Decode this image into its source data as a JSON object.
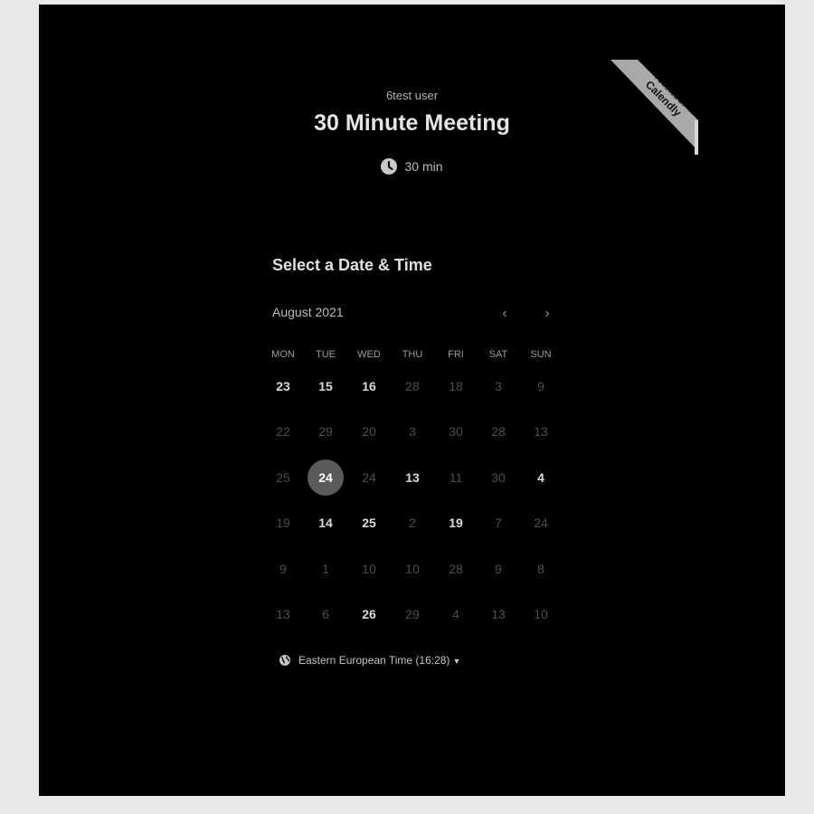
{
  "badge": {
    "top_text": "POWERED BY",
    "brand": "Calendly"
  },
  "event": {
    "owner": "6test user",
    "title": "30 Minute Meeting",
    "duration": "30 min"
  },
  "calendar": {
    "heading": "Select a Date & Time",
    "month_label": "August 2021",
    "weekdays": [
      "MON",
      "TUE",
      "WED",
      "THU",
      "FRI",
      "SAT",
      "SUN"
    ],
    "selected_day": "24",
    "days": [
      [
        {
          "label": "23",
          "available": true
        },
        {
          "label": "15",
          "available": true
        },
        {
          "label": "16",
          "available": true
        },
        {
          "label": "28",
          "available": false
        },
        {
          "label": "18",
          "available": false
        },
        {
          "label": "3",
          "available": false
        },
        {
          "label": "9",
          "available": false
        }
      ],
      [
        {
          "label": "22",
          "available": false
        },
        {
          "label": "29",
          "available": false
        },
        {
          "label": "20",
          "available": false
        },
        {
          "label": "3",
          "available": false
        },
        {
          "label": "30",
          "available": false
        },
        {
          "label": "28",
          "available": false
        },
        {
          "label": "13",
          "available": false
        }
      ],
      [
        {
          "label": "25",
          "available": false
        },
        {
          "label": "24",
          "available": true,
          "selected": true
        },
        {
          "label": "24",
          "available": false
        },
        {
          "label": "13",
          "available": true
        },
        {
          "label": "11",
          "available": false
        },
        {
          "label": "30",
          "available": false
        },
        {
          "label": "4",
          "available": true
        }
      ],
      [
        {
          "label": "19",
          "available": false
        },
        {
          "label": "14",
          "available": true
        },
        {
          "label": "25",
          "available": true
        },
        {
          "label": "2",
          "available": false
        },
        {
          "label": "19",
          "available": true
        },
        {
          "label": "7",
          "available": false
        },
        {
          "label": "24",
          "available": false
        }
      ],
      [
        {
          "label": "9",
          "available": false
        },
        {
          "label": "1",
          "available": false
        },
        {
          "label": "10",
          "available": false
        },
        {
          "label": "10",
          "available": false
        },
        {
          "label": "28",
          "available": false
        },
        {
          "label": "9",
          "available": false
        },
        {
          "label": "8",
          "available": false
        }
      ],
      [
        {
          "label": "13",
          "available": false
        },
        {
          "label": "6",
          "available": false
        },
        {
          "label": "26",
          "available": true
        },
        {
          "label": "29",
          "available": false
        },
        {
          "label": "4",
          "available": false
        },
        {
          "label": "13",
          "available": false
        },
        {
          "label": "10",
          "available": false
        }
      ]
    ]
  },
  "timezone": {
    "label": "Eastern European Time (16:28)"
  },
  "icons": {
    "duration": "clock-icon",
    "timezone": "globe-icon",
    "prev": "chevron-left-icon",
    "next": "chevron-right-icon",
    "tz_caret": "caret-down-icon"
  },
  "colors": {
    "background": "#000000",
    "page": "#e8e8e8",
    "badge": "#a9a9a9",
    "selected_day": "#5a5a5a"
  }
}
